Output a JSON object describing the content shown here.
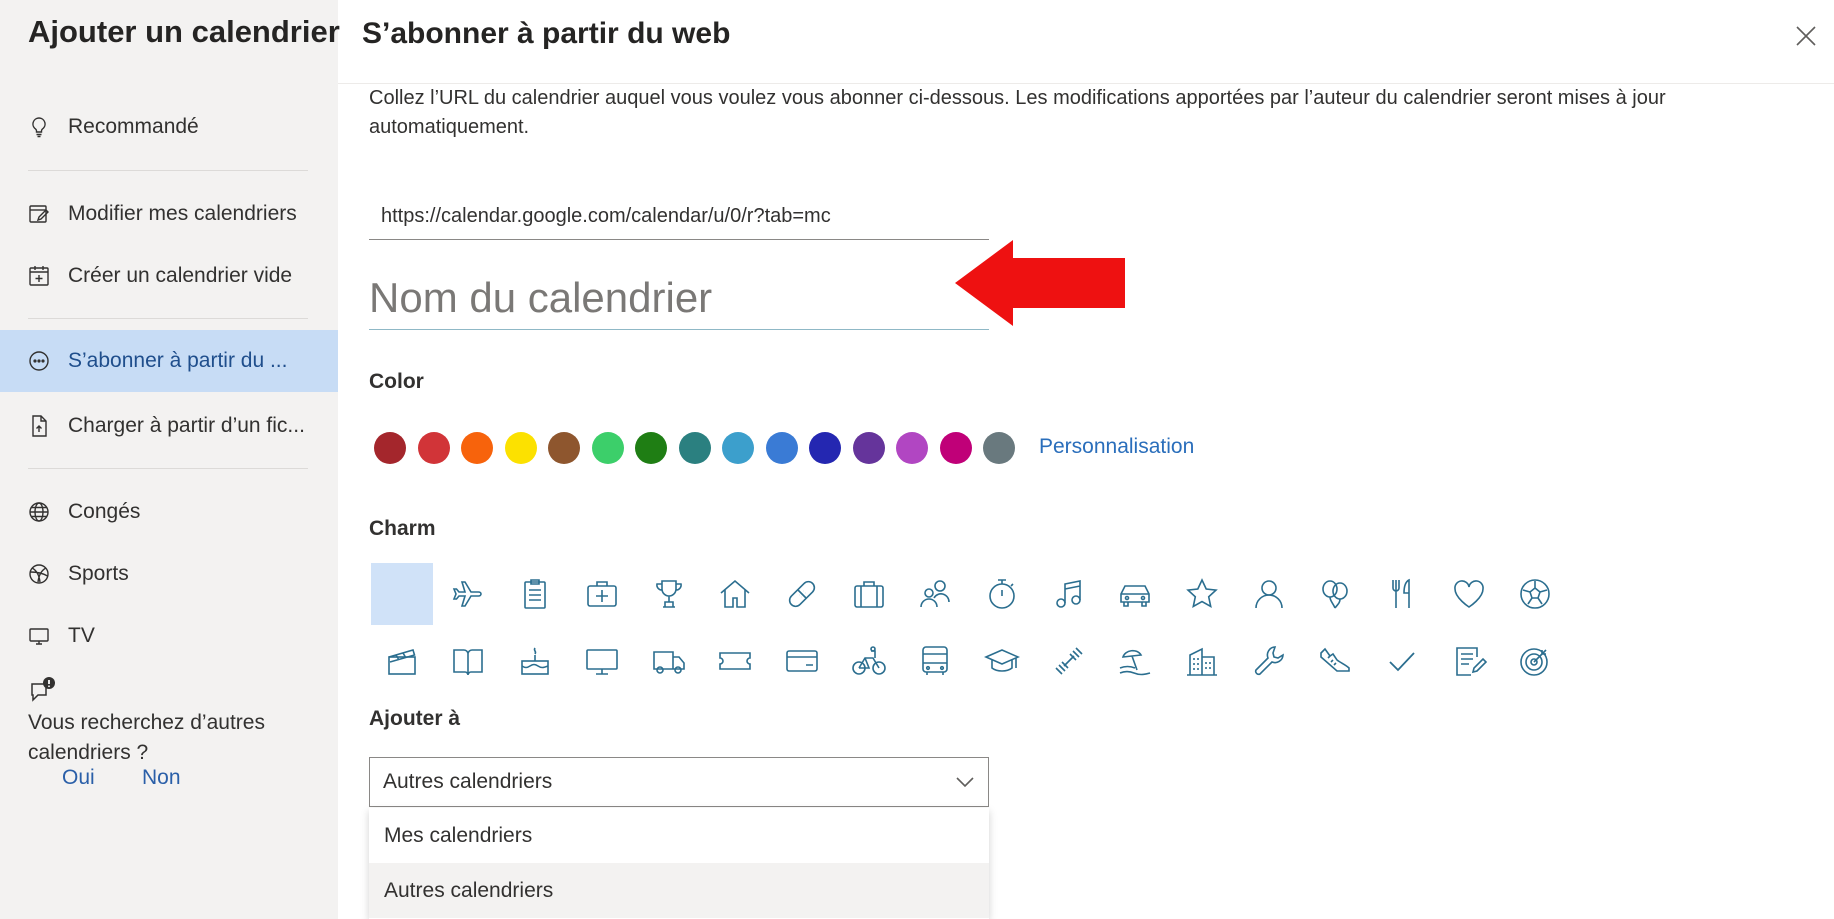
{
  "sidebar": {
    "title": "Ajouter un calendrier",
    "items": [
      {
        "label": "Recommandé",
        "icon": "lightbulb-icon"
      },
      {
        "label": "Modifier mes calendriers",
        "icon": "edit-calendar-icon"
      },
      {
        "label": "Créer un calendrier vide",
        "icon": "calendar-add-icon"
      },
      {
        "label": "S’abonner à partir du ...",
        "icon": "web-subscribe-icon",
        "selected": true
      },
      {
        "label": "Charger à partir d’un fic...",
        "icon": "file-upload-icon"
      },
      {
        "label": "Congés",
        "icon": "globe-icon"
      },
      {
        "label": "Sports",
        "icon": "sports-ball-icon"
      },
      {
        "label": "TV",
        "icon": "tv-icon"
      }
    ],
    "feedback": {
      "question": "Vous recherchez d’autres calendriers ?",
      "yes": "Oui",
      "no": "Non",
      "icon": "feedback-icon"
    }
  },
  "main": {
    "title": "S’abonner à partir du web",
    "description": "Collez l’URL du calendrier auquel vous voulez vous abonner ci-dessous. Les modifications apportées par l’auteur du calendrier seront mises à jour automatiquement.",
    "url_value": "https://calendar.google.com/calendar/u/0/r?tab=mc",
    "name_placeholder": "Nom du calendrier",
    "color_label": "Color",
    "colors": [
      "#a4262c",
      "#d13438",
      "#f7630c",
      "#fce100",
      "#8e562e",
      "#3ccf6a",
      "#1f7e14",
      "#2b8080",
      "#3c9fcc",
      "#3a7bd5",
      "#2427b1",
      "#65349b",
      "#b146c2",
      "#c00078",
      "#69797e"
    ],
    "custom_color_label": "Personnalisation",
    "charm_label": "Charm",
    "charms_row1": [
      "blank-charm",
      "airplane-icon",
      "clipboard-icon",
      "medical-kit-icon",
      "trophy-icon",
      "home-icon",
      "bandage-icon",
      "briefcase-icon",
      "people-icon",
      "stopwatch-icon",
      "music-note-icon",
      "car-icon",
      "star-icon",
      "person-icon",
      "balloons-icon",
      "fork-knife-icon",
      "heart-icon",
      "soccer-ball-icon"
    ],
    "charms_row2": [
      "clapperboard-icon",
      "book-icon",
      "birthday-cake-icon",
      "monitor-icon",
      "truck-icon",
      "ticket-icon",
      "credit-card-icon",
      "bicycle-icon",
      "bus-icon",
      "graduation-cap-icon",
      "dumbbell-icon",
      "beach-icon",
      "building-icon",
      "wrench-icon",
      "sneaker-icon",
      "checkmark-icon",
      "notepad-icon",
      "target-icon"
    ],
    "add_to_label": "Ajouter à",
    "add_to_value": "Autres calendriers",
    "add_to_options": [
      "Mes calendriers",
      "Autres calendriers"
    ]
  },
  "accent": {
    "selected_bg": "#c7dcf5",
    "link": "#2a6ebb",
    "arrow": "#ee1111"
  }
}
